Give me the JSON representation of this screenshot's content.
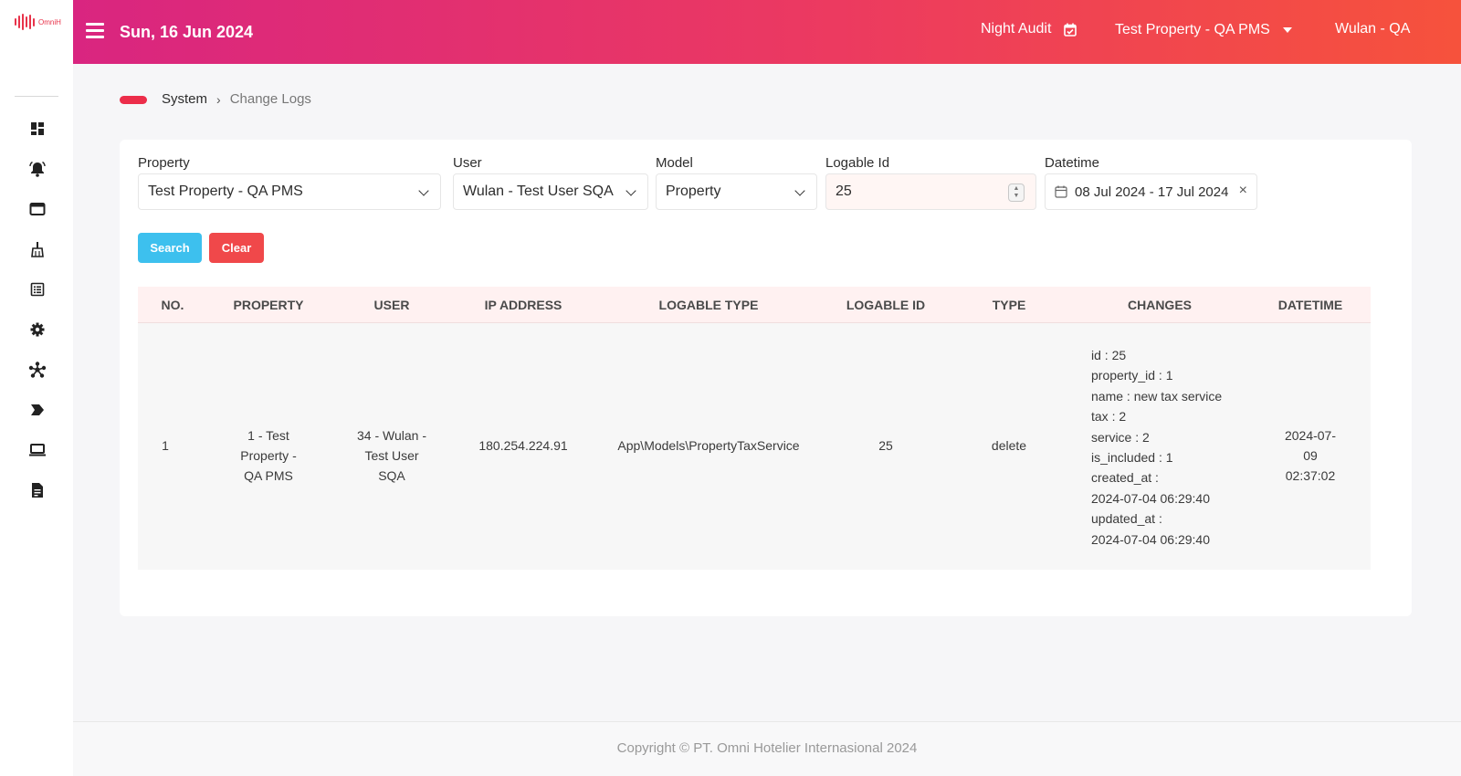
{
  "brand": {
    "name": "OmniH",
    "color": "#e8334a"
  },
  "header": {
    "date": "Sun, 16 Jun 2024",
    "night_audit": "Night Audit",
    "property": "Test Property - QA PMS",
    "user": "Wulan - QA",
    "gradient": [
      "#d92580",
      "#ec3a60",
      "#f6523c"
    ]
  },
  "sidebar": {
    "items": [
      "dashboard-icon",
      "notification-bell-icon",
      "window-icon",
      "housekeeping-icon",
      "list-icon",
      "settings-gear-icon",
      "network-icon",
      "tag-icon",
      "laptop-icon",
      "report-document-icon"
    ]
  },
  "breadcrumb": {
    "parent": "System",
    "separator": "›",
    "current": "Change Logs"
  },
  "filters": {
    "property": {
      "label": "Property",
      "value": "Test Property - QA PMS"
    },
    "user": {
      "label": "User",
      "value": "Wulan - Test User SQA"
    },
    "model": {
      "label": "Model",
      "value": "Property"
    },
    "logable_id": {
      "label": "Logable Id",
      "value": "25"
    },
    "datetime": {
      "label": "Datetime",
      "value": "08 Jul 2024 - 17 Jul 2024"
    }
  },
  "buttons": {
    "search": "Search",
    "clear": "Clear",
    "search_color": "#3dc0ee",
    "clear_color": "#f0484a"
  },
  "table": {
    "headers": [
      "NO.",
      "PROPERTY",
      "USER",
      "IP ADDRESS",
      "LOGABLE TYPE",
      "LOGABLE ID",
      "TYPE",
      "CHANGES",
      "DATETIME"
    ],
    "rows": [
      {
        "no": "1",
        "property": [
          "1 - Test",
          "Property -",
          "QA PMS"
        ],
        "user": [
          "34 - Wulan -",
          "Test User",
          "SQA"
        ],
        "ip": "180.254.224.91",
        "logable_type": "App\\Models\\PropertyTaxService",
        "logable_id": "25",
        "type": "delete",
        "changes": [
          "id : 25",
          "property_id : 1",
          "name : new tax service",
          "tax : 2",
          "service : 2",
          "is_included : 1",
          "created_at :",
          "2024-07-04 06:29:40",
          "updated_at :",
          "2024-07-04 06:29:40"
        ],
        "datetime": [
          "2024-07-09",
          "02:37:02"
        ]
      }
    ]
  },
  "footer": {
    "copyright": "Copyright © PT. Omni Hotelier Internasional 2024"
  }
}
